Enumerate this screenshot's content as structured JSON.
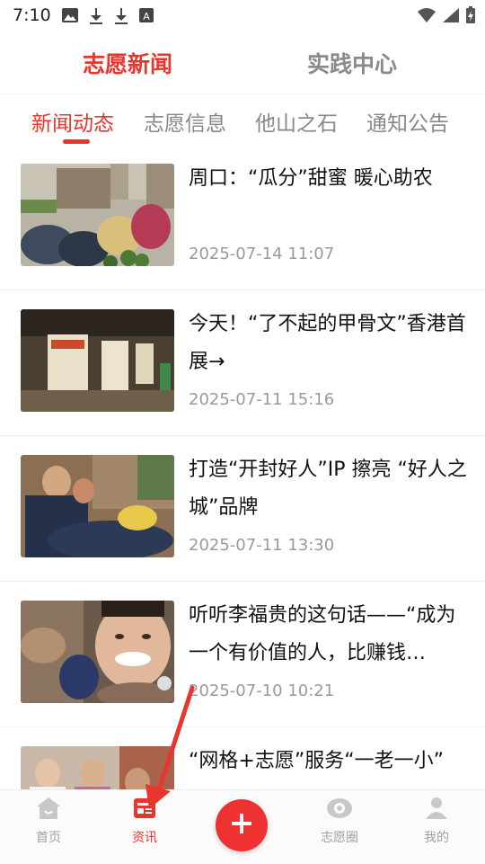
{
  "status_bar": {
    "time": "7:10",
    "icons_left": [
      "image-icon",
      "download-icon",
      "download-icon",
      "font-icon"
    ],
    "icons_right": [
      "wifi-icon",
      "signal-icon",
      "battery-icon"
    ]
  },
  "top_tabs": [
    {
      "label": "志愿新闻",
      "active": true
    },
    {
      "label": "实践中心",
      "active": false
    }
  ],
  "sub_tabs": [
    {
      "label": "新闻动态",
      "active": true
    },
    {
      "label": "志愿信息",
      "active": false
    },
    {
      "label": "他山之石",
      "active": false
    },
    {
      "label": "通知公告",
      "active": false
    }
  ],
  "news": [
    {
      "title": "周口：“瓜分”甜蜜 暖心助农",
      "date": "2025-07-14 11:07"
    },
    {
      "title": "今天！“了不起的甲骨文”香港首展→",
      "date": "2025-07-11 15:16"
    },
    {
      "title": "打造“开封好人”IP 擦亮 “好人之城”品牌",
      "date": "2025-07-11 13:30"
    },
    {
      "title": "听听李福贵的这句话——“成为一个有价值的人，比赚钱…",
      "date": "2025-07-10 10:21"
    },
    {
      "title": "“网格+志愿”服务“一老一小”",
      "date": ""
    }
  ],
  "bottom_nav": [
    {
      "label": "首页",
      "icon": "home-icon",
      "active": false
    },
    {
      "label": "资讯",
      "icon": "news-icon",
      "active": true
    },
    {
      "label": "",
      "icon": "plus-icon",
      "active": false
    },
    {
      "label": "志愿圈",
      "icon": "eye-icon",
      "active": false
    },
    {
      "label": "我的",
      "icon": "user-icon",
      "active": false
    }
  ],
  "colors": {
    "accent": "#e8352e",
    "muted": "#8a8a8a"
  }
}
